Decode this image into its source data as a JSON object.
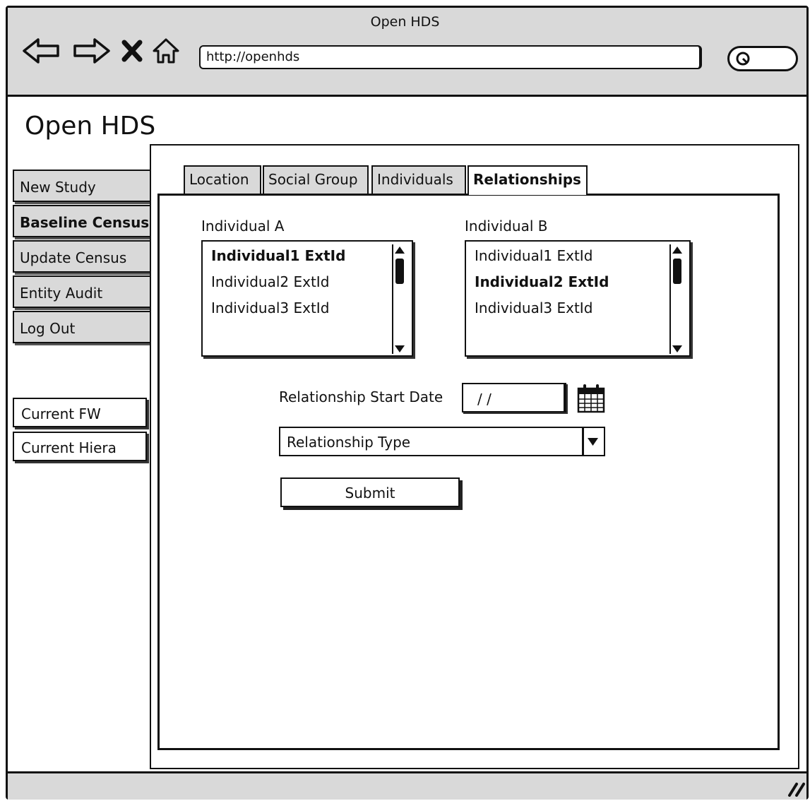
{
  "browser": {
    "title": "Open HDS",
    "url": "http://openhds"
  },
  "app": {
    "title": "Open HDS"
  },
  "sidebar": {
    "items": [
      {
        "label": "New Study",
        "bold": false
      },
      {
        "label": "Baseline Census",
        "bold": true
      },
      {
        "label": "Update Census",
        "bold": false
      },
      {
        "label": "Entity Audit",
        "bold": false
      },
      {
        "label": "Log Out",
        "bold": false
      }
    ],
    "info": [
      {
        "label": "Current FW"
      },
      {
        "label": "Current Hiera"
      }
    ]
  },
  "tabs": [
    {
      "label": "Location"
    },
    {
      "label": "Social Group"
    },
    {
      "label": "Individuals"
    },
    {
      "label": "Relationships",
      "active": true
    }
  ],
  "form": {
    "individual_a": {
      "label": "Individual A",
      "items": [
        "Individual1 ExtId",
        "Individual2 ExtId",
        "Individual3 ExtId"
      ],
      "selected": "Individual1 ExtId"
    },
    "individual_b": {
      "label": "Individual B",
      "items": [
        "Individual1 ExtId",
        "Individual2 ExtId",
        "Individual3 ExtId"
      ],
      "selected": "Individual2 ExtId"
    },
    "start_date": {
      "label": "Relationship Start Date",
      "value": "/ /"
    },
    "relationship_type": {
      "value": "Relationship Type"
    },
    "submit_label": "Submit"
  },
  "icons": {
    "back": "back-arrow-icon",
    "forward": "forward-arrow-icon",
    "stop": "close-icon",
    "home": "home-icon",
    "search": "search-icon",
    "calendar": "calendar-icon",
    "resize": "resize-grip-icon"
  }
}
